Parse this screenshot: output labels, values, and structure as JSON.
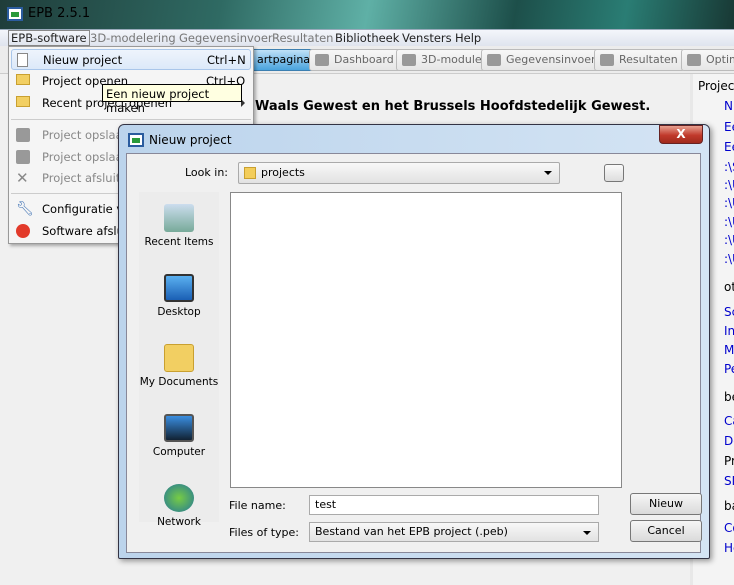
{
  "app": {
    "title": "EPB 2.5.1"
  },
  "menubar": [
    "EPB-software",
    "3D-modelering",
    "Gegevensinvoer",
    "Resultaten",
    "Bibliotheek",
    "Vensters",
    "Help"
  ],
  "toolbar": [
    "artpagina",
    "Dashboard",
    "3D-module",
    "Gegevensinvoer",
    "Resultaten",
    "Optim"
  ],
  "banner": "Waals Gewest en het Brussels Hoofdstedelijk Gewest.",
  "menu": {
    "items": [
      {
        "label": "Nieuw project",
        "shortcut": "Ctrl+N",
        "icon": "new-file-icon"
      },
      {
        "label": "Project openen",
        "shortcut": "Ctrl+O",
        "icon": "folder-open-icon"
      },
      {
        "label": "Recent project openen",
        "icon": "recent-folder-icon"
      },
      {
        "label": "Project opslaan",
        "icon": "save-icon"
      },
      {
        "label": "Project opslaan",
        "icon": "save-as-icon"
      },
      {
        "label": "Project afsluite",
        "icon": "close-x-icon"
      },
      {
        "label": "Configuratie v",
        "icon": "wrench-icon"
      },
      {
        "label": "Software afslui",
        "icon": "stop-icon"
      }
    ]
  },
  "tooltip": "Een nieuw project maken",
  "right_panel": {
    "group_title": "Project",
    "items": [
      "Ni",
      "Ee",
      "Ee",
      ":\\S",
      ":\\U",
      ":\\U",
      ":\\U",
      ":\\U",
      ":\\U",
      "oth",
      "Sc",
      "In",
      "M",
      "Pe",
      "be",
      "Ca",
      "Do",
      "Pr",
      "SN",
      "bas",
      "Co",
      "He"
    ]
  },
  "dialog": {
    "title": "Nieuw project",
    "look_in_label": "Look in:",
    "look_in_value": "projects",
    "places": [
      "Recent Items",
      "Desktop",
      "My Documents",
      "Computer",
      "Network"
    ],
    "file_name_label": "File name:",
    "file_name_value": "test",
    "files_of_type_label": "Files of type:",
    "files_of_type_value": "Bestand van het EPB project (.peb)",
    "ok_label": "Nieuw",
    "cancel_label": "Cancel",
    "close_label": "X"
  }
}
